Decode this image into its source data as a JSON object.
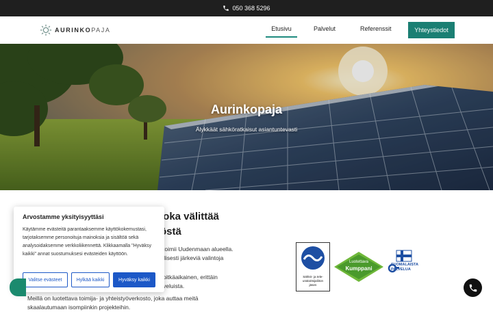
{
  "topbar": {
    "phone": "050 368 5296",
    "icon": "phone-icon"
  },
  "header": {
    "logo_bold": "AURINKO",
    "logo_light": "PAJA",
    "nav": [
      {
        "label": "Etusivu",
        "active": true
      },
      {
        "label": "Palvelut",
        "active": false
      },
      {
        "label": "Referenssit",
        "active": false
      }
    ],
    "cta_label": "Yhteystiedot",
    "accent_color": "#1b7f73"
  },
  "hero": {
    "title": "Aurinkopaja",
    "subtitle": "Älykkäät sähköratkaisut asiantuntevasti"
  },
  "main": {
    "headline_line1": "joka välittää",
    "headline_line2": "östä",
    "paragraph1_line1": "toimii Uudenmaan alueella.",
    "paragraph1_line2": "llisesti järkeviä valintoja",
    "paragraph2_line1": "pitkäaikainen, erittäin",
    "paragraph2_line2": "veluista.",
    "paragraph3_line1": "Meillä on luotettava toimija- ja yhteistyöverkosto, joka auttaa meitä",
    "paragraph3_line2": "skaalautumaan isompiinkin projekteihin."
  },
  "certifications": {
    "stul_text_line1": "Sähkö- ja tele-",
    "stul_text_line2": "urakoitsijaliiton",
    "stul_text_line3": "jäsen",
    "partner_line1": "Luotettava",
    "partner_line2": "Kumppani",
    "finnish_line1": "SUOMALAISTA",
    "finnish_line2": "PALVELUA"
  },
  "cookie_banner": {
    "title": "Arvostamme yksityisyyttäsi",
    "text": "Käytämme evästeitä parantaaksemme käyttökokemustasi, tarjotaksemme personoituja mainoksia ja sisältöä sekä analysoidaksemme verkkoliikennettä. Klikkaamalla \"Hyväksy kaikki\" annat suostumuksesi evästeiden käyttöön.",
    "btn_customize": "Valitse evästeet",
    "btn_reject": "Hylkää kaikki",
    "btn_accept": "Hyväksy kaikki",
    "button_color": "#1c58c7"
  }
}
